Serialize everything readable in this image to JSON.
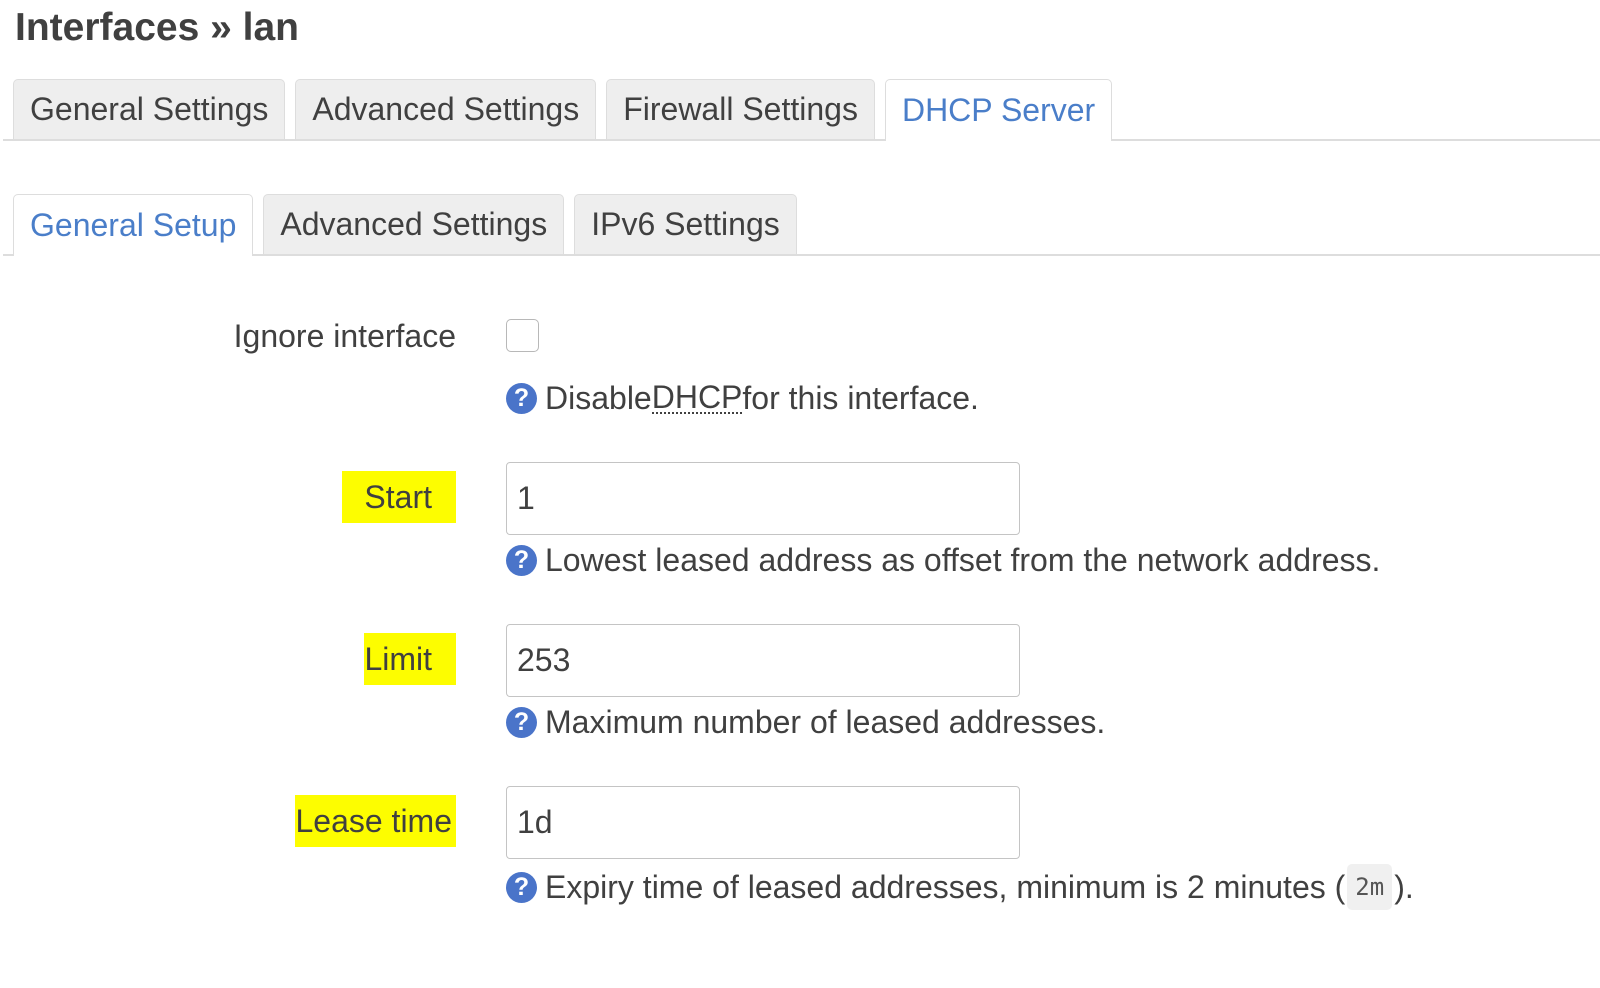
{
  "page": {
    "title": "Interfaces » lan"
  },
  "top_tabs": [
    {
      "label": "General Settings",
      "active": false
    },
    {
      "label": "Advanced Settings",
      "active": false
    },
    {
      "label": "Firewall Settings",
      "active": false
    },
    {
      "label": "DHCP Server",
      "active": true
    }
  ],
  "sub_tabs": [
    {
      "label": "General Setup",
      "active": true
    },
    {
      "label": "Advanced Settings",
      "active": false
    },
    {
      "label": "IPv6 Settings",
      "active": false
    }
  ],
  "form": {
    "ignore_interface": {
      "label": "Ignore interface",
      "checked": false,
      "hint_before": "Disable ",
      "hint_abbr": "DHCP",
      "hint_after": " for this interface."
    },
    "start": {
      "label": "Start",
      "value": "1",
      "hint": "Lowest leased address as offset from the network address."
    },
    "limit": {
      "label": "Limit",
      "value": "253",
      "hint": "Maximum number of leased addresses."
    },
    "lease_time": {
      "label": "Lease time",
      "value": "1d",
      "hint_before": "Expiry time of leased addresses, minimum is 2 minutes (",
      "hint_code": "2m",
      "hint_after": ")."
    }
  },
  "icons": {
    "help": "?"
  },
  "colors": {
    "accent": "#4a7ec9",
    "help_icon": "#4a74c9",
    "highlight": "#fdfd00",
    "text": "#404040"
  }
}
